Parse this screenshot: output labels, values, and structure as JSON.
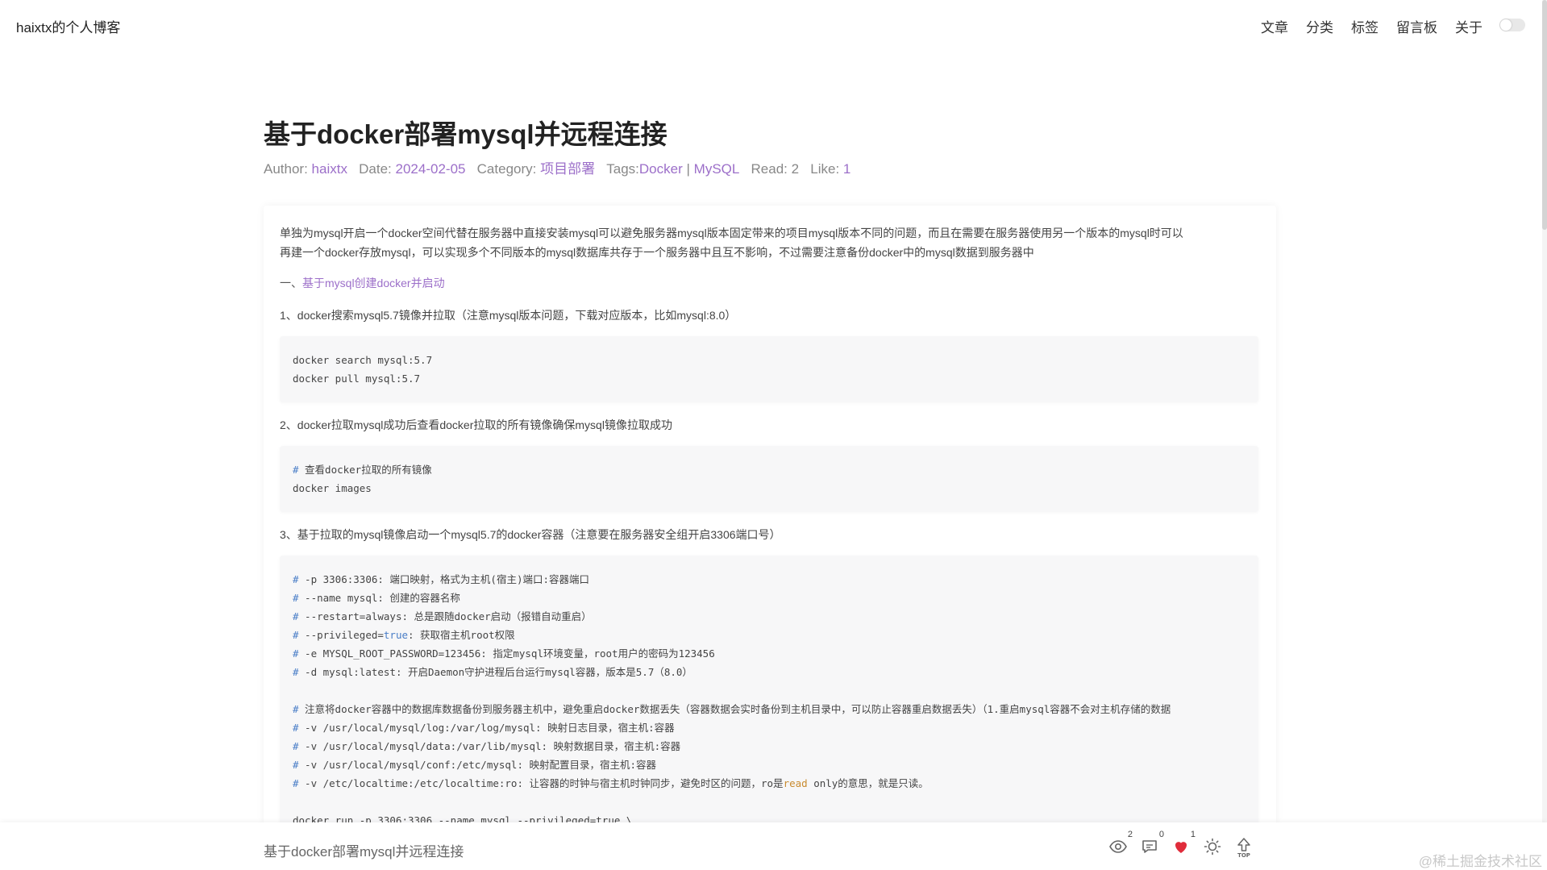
{
  "header": {
    "site_title": "haixtx的个人博客",
    "nav": [
      "文章",
      "分类",
      "标签",
      "留言板",
      "关于"
    ]
  },
  "article": {
    "title": "基于docker部署mysql并远程连接",
    "meta": {
      "author_label": "Author:",
      "author": "haixtx",
      "date_label": "Date:",
      "date": "2024-02-05",
      "category_label": "Category:",
      "category": "项目部署",
      "tags_label": "Tags:",
      "tag1": "Docker",
      "tag_sep": "|",
      "tag2": "MySQL",
      "read_label": "Read:",
      "read": "2",
      "like_label": "Like:",
      "like": "1"
    },
    "intro_line1": "单独为mysql开启一个docker空间代替在服务器中直接安装mysql可以避免服务器mysql版本固定带来的项目mysql版本不同的问题，而且在需要在服务器使用另一个版本的mysql时可以",
    "intro_line2": "再建一个docker存放mysql，可以实现多个不同版本的mysql数据库共存于一个服务器中且互不影响，不过需要注意备份docker中的mysql数据到服务器中",
    "section1_prefix": "一、",
    "section1": "基于mysql创建docker并启动",
    "step1": "1、docker搜索mysql5.7镜像并拉取（注意mysql版本问题，下载对应版本，比如mysql:8.0）",
    "code1": [
      "docker search mysql:5.7",
      "docker pull mysql:5.7"
    ],
    "step2": "2、docker拉取mysql成功后查看docker拉取的所有镜像确保mysql镜像拉取成功",
    "code2_comment": " 查看docker拉取的所有镜像",
    "code2_line2": "docker images",
    "step3": "3、基于拉取的mysql镜像启动一个mysql5.7的docker容器（注意要在服务器安全组开启3306端口号）",
    "code3": {
      "hash": "#",
      "c1": " -p 3306:3306: 端口映射，格式为主机(宿主)端口:容器端口",
      "c2": " --name mysql: 创建的容器名称",
      "c3": " --restart=always: 总是跟随docker启动（报错自动重启）",
      "c4_pre": " --privileged=",
      "c4_kw": "true",
      "c4_post": ": 获取宿主机root权限",
      "c5": " -e MYSQL_ROOT_PASSWORD=123456: 指定mysql环境变量，root用户的密码为123456",
      "c6": " -d mysql:latest: 开启Daemon守护进程后台运行mysql容器，版本是5.7（8.0）",
      "c7": " 注意将docker容器中的数据库数据备份到服务器主机中，避免重启docker数据丢失（容器数据会实时备份到主机目录中，可以防止容器重启数据丢失）（1.重启mysql容器不会对主机存储的数据",
      "c8": " -v /usr/local/mysql/log:/var/log/mysql: 映射日志目录，宿主机:容器",
      "c9": " -v /usr/local/mysql/data:/var/lib/mysql: 映射数据目录，宿主机:容器",
      "c10": " -v /usr/local/mysql/conf:/etc/mysql: 映射配置目录，宿主机:容器",
      "c11_pre": " -v /etc/localtime:/etc/localtime:ro: 让容器的时钟与宿主机时钟同步，避免时区的问题，ro是",
      "c11_kw": "read",
      "c11_post": " only的意思，就是只读。",
      "c12": "docker run -p 3306:3306 --name mysql --privileged=true \\"
    }
  },
  "bottom_bar": {
    "title": "基于docker部署mysql并远程连接",
    "views": "2",
    "comments": "0",
    "likes": "1",
    "watermark": "@稀土掘金技术社区"
  },
  "colors": {
    "accent": "#9c6fc9",
    "like": "#e02c3b",
    "comment_hash": "#4a7ec7"
  }
}
